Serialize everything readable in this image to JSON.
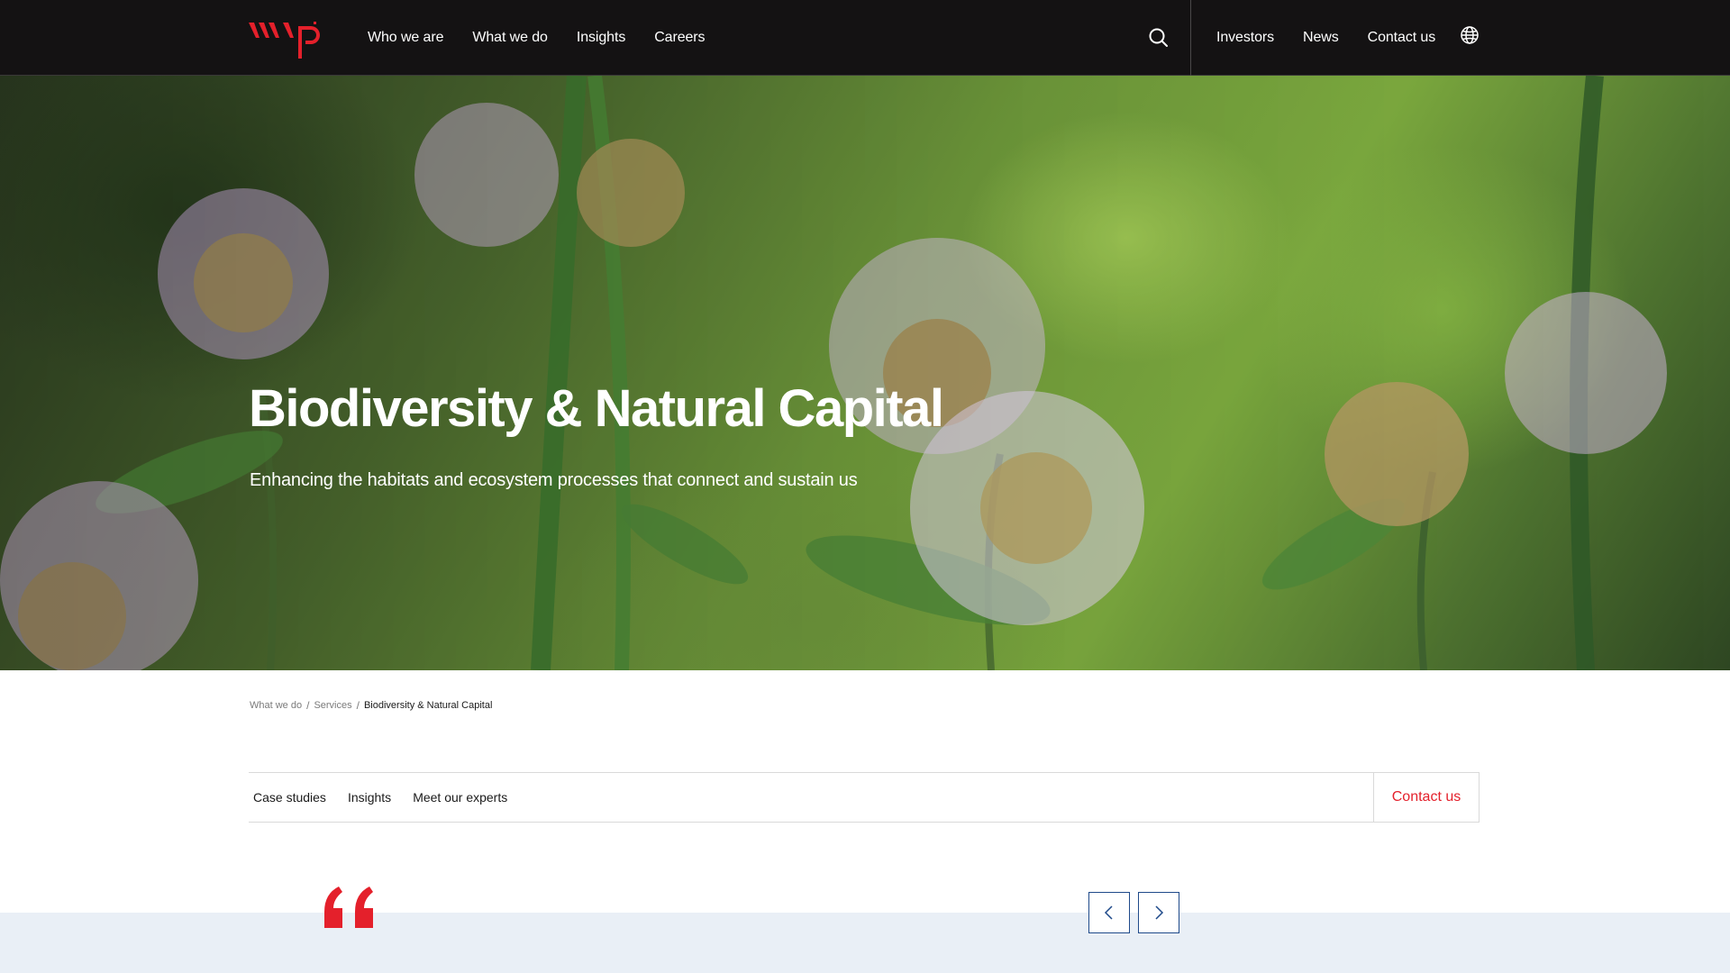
{
  "header": {
    "logo_text": "wsp",
    "nav_left": [
      "Who we are",
      "What we do",
      "Insights",
      "Careers"
    ],
    "nav_right": [
      "Investors",
      "News",
      "Contact us"
    ],
    "icons": {
      "search": "search-icon",
      "language": "globe-icon",
      "logo": "wsp-logo"
    }
  },
  "hero": {
    "title": "Biodiversity & Natural Capital",
    "subtitle": "Enhancing the habitats and ecosystem processes that connect and sustain us"
  },
  "breadcrumb": {
    "items": [
      "What we do",
      "Services"
    ],
    "separator": "/",
    "current": "Biodiversity & Natural Capital"
  },
  "subnav": {
    "links": [
      "Case studies",
      "Insights",
      "Meet our experts"
    ],
    "contact_label": "Contact us"
  },
  "quote": {
    "icons": {
      "quote": "quote-mark-icon",
      "prev": "chevron-left-icon",
      "next": "chevron-right-icon"
    }
  },
  "colors": {
    "brand_red": "#e4202b",
    "topbar_bg": "#141213",
    "accent_blue": "#1f4a8a",
    "quote_band": "#e9eff6"
  }
}
